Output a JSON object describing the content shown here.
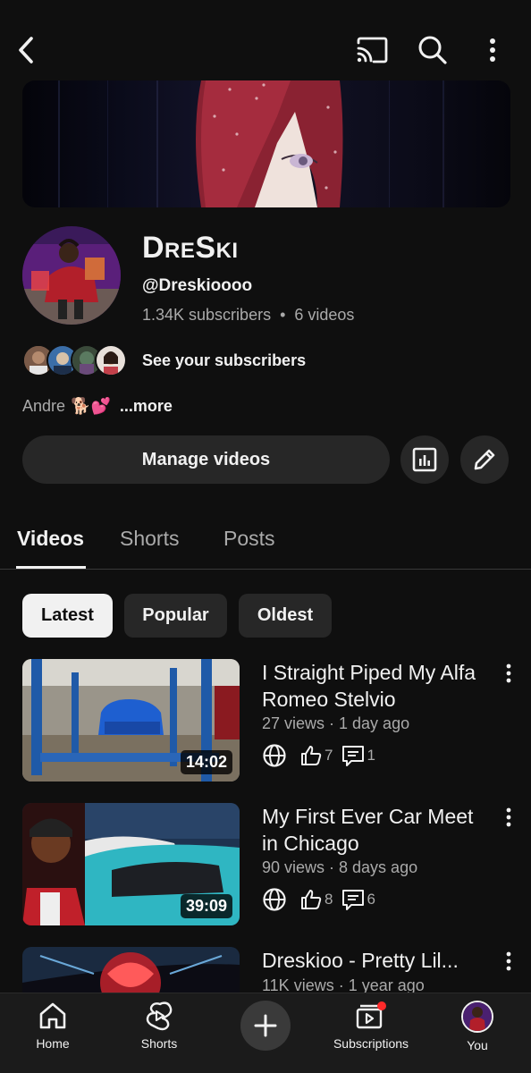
{
  "topbar": {
    "back_icon": "chevron-left-icon",
    "cast_icon": "cast-icon",
    "search_icon": "search-icon",
    "more_icon": "vertical-dots-icon"
  },
  "channel": {
    "name": "DreSki",
    "handle": "@Dreskioooo",
    "subscribers": "1.34K subscribers",
    "separator": "•",
    "videos": "6 videos",
    "see_subscribers": "See your subscribers",
    "description": "Andre",
    "description_emoji": "🐕💕",
    "more": "...more"
  },
  "actions": {
    "manage_videos": "Manage videos",
    "analytics_icon": "analytics-icon",
    "edit_icon": "pencil-icon"
  },
  "tabs": [
    {
      "label": "Videos",
      "active": true
    },
    {
      "label": "Shorts",
      "active": false
    },
    {
      "label": "Posts",
      "active": false
    }
  ],
  "chips": [
    {
      "label": "Latest",
      "active": true
    },
    {
      "label": "Popular",
      "active": false
    },
    {
      "label": "Oldest",
      "active": false
    }
  ],
  "videos": [
    {
      "title": "I Straight Piped My Alfa Romeo Stelvio",
      "meta": "27 views · 1 day ago",
      "duration": "14:02",
      "likes": "7",
      "comments": "1"
    },
    {
      "title": "My First Ever Car Meet in Chicago",
      "meta": "90 views · 8 days ago",
      "duration": "39:09",
      "likes": "8",
      "comments": "6"
    },
    {
      "title": "Dreskioo - Pretty Lil...",
      "meta": "11K views · 1 year ago"
    }
  ],
  "bottom_nav": {
    "home": "Home",
    "shorts": "Shorts",
    "subscriptions": "Subscriptions",
    "you": "You"
  }
}
